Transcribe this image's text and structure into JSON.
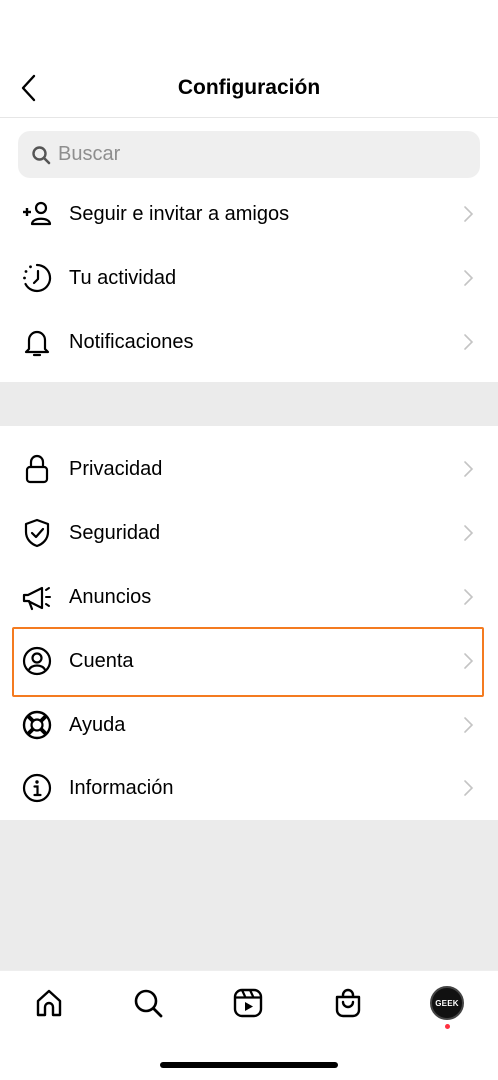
{
  "header": {
    "title": "Configuración"
  },
  "search": {
    "placeholder": "Buscar"
  },
  "section1": [
    {
      "label": "Seguir e invitar a amigos",
      "icon": "add-person-icon"
    },
    {
      "label": "Tu actividad",
      "icon": "activity-clock-icon"
    },
    {
      "label": "Notificaciones",
      "icon": "bell-icon"
    }
  ],
  "section2": [
    {
      "label": "Privacidad",
      "icon": "lock-icon"
    },
    {
      "label": "Seguridad",
      "icon": "shield-check-icon"
    },
    {
      "label": "Anuncios",
      "icon": "megaphone-icon"
    },
    {
      "label": "Cuenta",
      "icon": "account-circle-icon"
    },
    {
      "label": "Ayuda",
      "icon": "lifebuoy-icon"
    },
    {
      "label": "Información",
      "icon": "info-icon"
    }
  ],
  "tabbar": {
    "tabs": [
      "home-icon",
      "search-icon",
      "reels-icon",
      "shop-icon",
      "profile-avatar"
    ],
    "avatar_text": "GEEK"
  },
  "colors": {
    "highlight": "#f47b20",
    "notification_dot": "#ff3040",
    "divider": "#ebebeb"
  }
}
